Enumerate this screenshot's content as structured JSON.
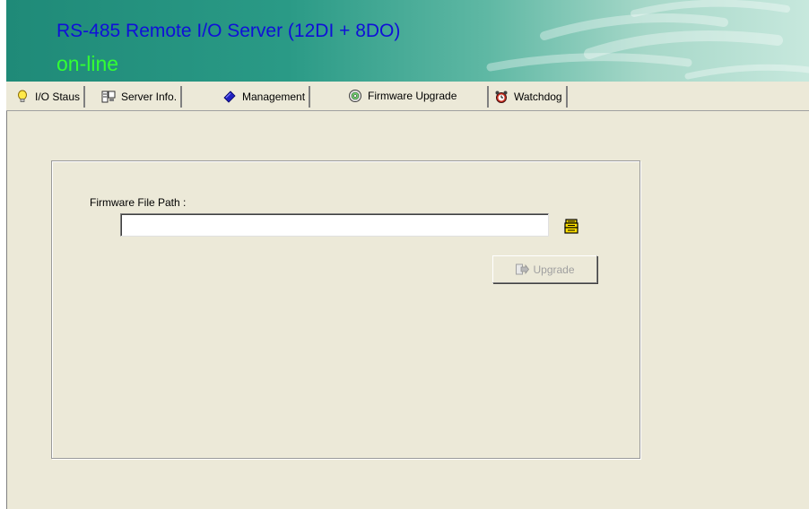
{
  "header": {
    "title": "RS-485 Remote I/O Server (12DI + 8DO)",
    "status": "on-line",
    "title_color": "#1010d8",
    "status_color": "#33ff33"
  },
  "tabs": [
    {
      "label": "I/O Staus",
      "icon": "lightbulb-icon"
    },
    {
      "label": "Server Info.",
      "icon": "server-icon"
    },
    {
      "label": "Management",
      "icon": "management-icon"
    },
    {
      "label": "Firmware Upgrade",
      "icon": "disc-icon",
      "active": true
    },
    {
      "label": "Watchdog",
      "icon": "alarm-clock-icon"
    }
  ],
  "firmware": {
    "path_label": "Firmware File Path :",
    "path_value": "",
    "upgrade_label": "Upgrade",
    "upgrade_enabled": false,
    "browse_icon": "browse-folder-icon"
  }
}
